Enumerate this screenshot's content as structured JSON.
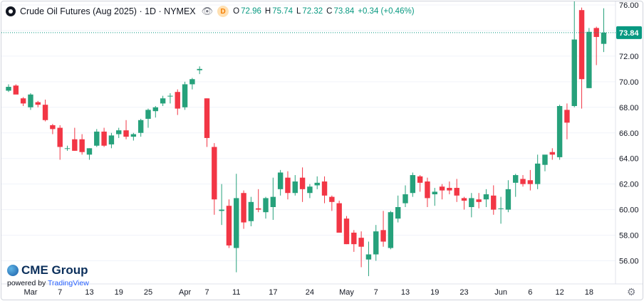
{
  "header": {
    "title": "Crude Oil Futures (Aug 2025) · 1D · NYMEX",
    "delay_badge": "D",
    "ohlc": {
      "o_label": "O",
      "o": "72.96",
      "h_label": "H",
      "h": "75.74",
      "l_label": "L",
      "l": "72.32",
      "c_label": "C",
      "c": "73.84",
      "change": "+0.34 (+0.46%)"
    }
  },
  "branding": {
    "logo_text": "CME Group",
    "powered_prefix": "powered by ",
    "powered_brand": "TradingView"
  },
  "colors": {
    "up": "#26a17b",
    "down": "#f23645",
    "last_price": "#089981",
    "grid": "#f0f3fa"
  },
  "chart_data": {
    "type": "candlestick",
    "ylim": [
      54.5,
      76.2
    ],
    "y_ticks": [
      "56.00",
      "58.00",
      "60.00",
      "62.00",
      "64.00",
      "66.00",
      "68.00",
      "70.00",
      "72.00",
      "74.00",
      "76.00"
    ],
    "x_ticks": [
      "Mar",
      "7",
      "13",
      "19",
      "25",
      "Apr",
      "7",
      "11",
      "17",
      "24",
      "May",
      "7",
      "13",
      "19",
      "23",
      "Jun",
      "6",
      "12",
      "18"
    ],
    "last_price": "73.84",
    "candles": [
      {
        "x": "Feb 25",
        "o": 69.3,
        "h": 69.8,
        "l": 69.2,
        "c": 69.6
      },
      {
        "x": "Feb 26",
        "o": 69.7,
        "h": 69.8,
        "l": 69.1,
        "c": 69.0
      },
      {
        "x": "Feb 27",
        "o": 68.7,
        "h": 68.8,
        "l": 68.1,
        "c": 68.3
      },
      {
        "x": "Feb 28",
        "o": 68.0,
        "h": 69.1,
        "l": 67.8,
        "c": 69.0
      },
      {
        "x": "Mar 3",
        "o": 68.4,
        "h": 68.5,
        "l": 68.0,
        "c": 68.2
      },
      {
        "x": "Mar 4",
        "o": 68.2,
        "h": 68.6,
        "l": 66.9,
        "c": 67.0
      },
      {
        "x": "Mar 5",
        "o": 66.6,
        "h": 66.7,
        "l": 65.9,
        "c": 66.3
      },
      {
        "x": "Mar 6",
        "o": 66.4,
        "h": 66.6,
        "l": 63.9,
        "c": 64.9
      },
      {
        "x": "Mar 7",
        "o": 64.8,
        "h": 65.0,
        "l": 64.6,
        "c": 64.8
      },
      {
        "x": "Mar 10",
        "o": 65.5,
        "h": 66.4,
        "l": 64.6,
        "c": 64.6
      },
      {
        "x": "Mar 11",
        "o": 65.5,
        "h": 65.9,
        "l": 64.3,
        "c": 64.5
      },
      {
        "x": "Mar 12",
        "o": 64.3,
        "h": 64.8,
        "l": 63.9,
        "c": 64.8
      },
      {
        "x": "Mar 13",
        "o": 65.0,
        "h": 66.3,
        "l": 64.9,
        "c": 66.1
      },
      {
        "x": "Mar 14",
        "o": 66.1,
        "h": 66.4,
        "l": 64.9,
        "c": 65.0
      },
      {
        "x": "Mar 17",
        "o": 65.1,
        "h": 66.0,
        "l": 64.8,
        "c": 65.8
      },
      {
        "x": "Mar 18",
        "o": 65.9,
        "h": 66.4,
        "l": 65.6,
        "c": 66.2
      },
      {
        "x": "Mar 19",
        "o": 66.2,
        "h": 67.0,
        "l": 65.5,
        "c": 65.7
      },
      {
        "x": "Mar 20",
        "o": 65.7,
        "h": 66.0,
        "l": 65.4,
        "c": 65.9
      },
      {
        "x": "Mar 21",
        "o": 66.0,
        "h": 67.1,
        "l": 65.7,
        "c": 67.0
      },
      {
        "x": "Mar 24",
        "o": 67.1,
        "h": 67.9,
        "l": 66.4,
        "c": 67.8
      },
      {
        "x": "Mar 25",
        "o": 67.7,
        "h": 68.1,
        "l": 67.2,
        "c": 68.0
      },
      {
        "x": "Mar 26",
        "o": 68.3,
        "h": 68.9,
        "l": 68.1,
        "c": 68.7
      },
      {
        "x": "Mar 27",
        "o": 68.9,
        "h": 69.1,
        "l": 68.3,
        "c": 68.9
      },
      {
        "x": "Mar 28",
        "o": 69.2,
        "h": 69.4,
        "l": 67.4,
        "c": 67.9
      },
      {
        "x": "Mar 31",
        "o": 68.0,
        "h": 70.0,
        "l": 67.8,
        "c": 69.8
      },
      {
        "x": "Apr 1",
        "o": 69.8,
        "h": 70.3,
        "l": 69.4,
        "c": 70.2
      },
      {
        "x": "Apr 2",
        "o": 70.9,
        "h": 71.2,
        "l": 70.6,
        "c": 71.0
      },
      {
        "x": "Apr 3",
        "o": 68.7,
        "h": 68.7,
        "l": 64.9,
        "c": 65.6
      },
      {
        "x": "Apr 4",
        "o": 64.9,
        "h": 65.2,
        "l": 59.6,
        "c": 60.8
      },
      {
        "x": "Apr 7",
        "o": 59.9,
        "h": 62.0,
        "l": 58.8,
        "c": 60.0
      },
      {
        "x": "Apr 8",
        "o": 60.3,
        "h": 60.8,
        "l": 57.0,
        "c": 57.2
      },
      {
        "x": "Apr 9",
        "o": 57.0,
        "h": 62.8,
        "l": 55.1,
        "c": 60.9
      },
      {
        "x": "Apr 10",
        "o": 61.3,
        "h": 61.5,
        "l": 58.5,
        "c": 59.0
      },
      {
        "x": "Apr 11",
        "o": 59.1,
        "h": 61.0,
        "l": 58.7,
        "c": 60.6
      },
      {
        "x": "Apr 14",
        "o": 60.1,
        "h": 61.6,
        "l": 59.8,
        "c": 60.0
      },
      {
        "x": "Apr 15",
        "o": 59.8,
        "h": 61.0,
        "l": 59.3,
        "c": 60.9
      },
      {
        "x": "Apr 16",
        "o": 60.2,
        "h": 62.5,
        "l": 59.2,
        "c": 61.0
      },
      {
        "x": "Apr 17",
        "o": 61.6,
        "h": 63.1,
        "l": 61.1,
        "c": 62.9
      },
      {
        "x": "Apr 21",
        "o": 62.5,
        "h": 63.0,
        "l": 60.8,
        "c": 61.3
      },
      {
        "x": "Apr 22",
        "o": 61.3,
        "h": 62.7,
        "l": 61.1,
        "c": 62.2
      },
      {
        "x": "Apr 23",
        "o": 62.5,
        "h": 63.3,
        "l": 60.6,
        "c": 61.6
      },
      {
        "x": "Apr 24",
        "o": 61.3,
        "h": 62.0,
        "l": 60.9,
        "c": 61.8
      },
      {
        "x": "Apr 25",
        "o": 61.9,
        "h": 62.6,
        "l": 61.6,
        "c": 62.1
      },
      {
        "x": "Apr 28",
        "o": 62.2,
        "h": 62.6,
        "l": 60.5,
        "c": 61.1
      },
      {
        "x": "Apr 29",
        "o": 61.0,
        "h": 61.1,
        "l": 59.9,
        "c": 60.6
      },
      {
        "x": "Apr 30",
        "o": 60.5,
        "h": 60.7,
        "l": 58.4,
        "c": 58.2
      },
      {
        "x": "May 1",
        "o": 59.3,
        "h": 59.5,
        "l": 57.3,
        "c": 57.3
      },
      {
        "x": "May 2",
        "o": 58.2,
        "h": 58.4,
        "l": 56.7,
        "c": 57.3
      },
      {
        "x": "May 5",
        "o": 57.8,
        "h": 58.3,
        "l": 55.5,
        "c": 57.1
      },
      {
        "x": "May 6",
        "o": 56.1,
        "h": 57.5,
        "l": 54.8,
        "c": 56.5
      },
      {
        "x": "May 7",
        "o": 56.5,
        "h": 58.8,
        "l": 56.0,
        "c": 58.3
      },
      {
        "x": "May 8",
        "o": 58.4,
        "h": 59.9,
        "l": 57.1,
        "c": 57.5
      },
      {
        "x": "May 9",
        "o": 57.0,
        "h": 59.9,
        "l": 56.9,
        "c": 59.8
      },
      {
        "x": "May 12",
        "o": 59.3,
        "h": 61.1,
        "l": 59.0,
        "c": 60.2
      },
      {
        "x": "May 13",
        "o": 60.5,
        "h": 61.9,
        "l": 60.2,
        "c": 61.2
      },
      {
        "x": "May 14",
        "o": 61.3,
        "h": 62.9,
        "l": 61.0,
        "c": 62.7
      },
      {
        "x": "May 15",
        "o": 62.6,
        "h": 62.7,
        "l": 61.4,
        "c": 62.1
      },
      {
        "x": "May 16",
        "o": 62.2,
        "h": 62.5,
        "l": 60.2,
        "c": 60.9
      },
      {
        "x": "May 19",
        "o": 61.2,
        "h": 61.7,
        "l": 60.3,
        "c": 61.4
      },
      {
        "x": "May 20",
        "o": 61.8,
        "h": 62.0,
        "l": 60.8,
        "c": 61.5
      },
      {
        "x": "May 21",
        "o": 61.7,
        "h": 62.2,
        "l": 61.2,
        "c": 61.5
      },
      {
        "x": "May 22",
        "o": 61.7,
        "h": 62.4,
        "l": 60.6,
        "c": 61.1
      },
      {
        "x": "May 23",
        "o": 60.9,
        "h": 61.0,
        "l": 60.0,
        "c": 60.7
      },
      {
        "x": "May 26",
        "o": 60.2,
        "h": 61.3,
        "l": 59.4,
        "c": 60.9
      },
      {
        "x": "May 27",
        "o": 60.8,
        "h": 61.3,
        "l": 60.1,
        "c": 60.6
      },
      {
        "x": "May 28",
        "o": 60.8,
        "h": 61.6,
        "l": 60.2,
        "c": 61.2
      },
      {
        "x": "May 29",
        "o": 61.1,
        "h": 61.9,
        "l": 59.6,
        "c": 60.0
      },
      {
        "x": "May 30",
        "o": 60.1,
        "h": 61.0,
        "l": 58.9,
        "c": 60.1
      },
      {
        "x": "Jun 2",
        "o": 60.0,
        "h": 62.3,
        "l": 59.8,
        "c": 61.6
      },
      {
        "x": "Jun 3",
        "o": 62.1,
        "h": 62.8,
        "l": 61.0,
        "c": 62.7
      },
      {
        "x": "Jun 4",
        "o": 62.4,
        "h": 62.7,
        "l": 61.8,
        "c": 62.0
      },
      {
        "x": "Jun 5",
        "o": 62.3,
        "h": 63.1,
        "l": 61.5,
        "c": 62.0
      },
      {
        "x": "Jun 6",
        "o": 62.0,
        "h": 64.3,
        "l": 61.6,
        "c": 63.6
      },
      {
        "x": "Jun 9",
        "o": 63.5,
        "h": 64.0,
        "l": 63.0,
        "c": 64.3
      },
      {
        "x": "Jun 10",
        "o": 64.5,
        "h": 64.8,
        "l": 63.9,
        "c": 64.3
      },
      {
        "x": "Jun 11",
        "o": 64.1,
        "h": 68.2,
        "l": 63.9,
        "c": 68.1
      },
      {
        "x": "Jun 12",
        "o": 67.8,
        "h": 68.3,
        "l": 65.5,
        "c": 66.8
      },
      {
        "x": "Jun 13",
        "o": 68.1,
        "h": 77.4,
        "l": 68.0,
        "c": 73.3
      },
      {
        "x": "Jun 16",
        "o": 75.6,
        "h": 75.8,
        "l": 67.9,
        "c": 70.2
      },
      {
        "x": "Jun 17",
        "o": 69.5,
        "h": 74.2,
        "l": 69.5,
        "c": 73.9
      },
      {
        "x": "Jun 18",
        "o": 74.2,
        "h": 74.3,
        "l": 71.3,
        "c": 73.5
      },
      {
        "x": "Jun 19",
        "o": 72.96,
        "h": 75.74,
        "l": 72.32,
        "c": 73.84
      }
    ]
  }
}
